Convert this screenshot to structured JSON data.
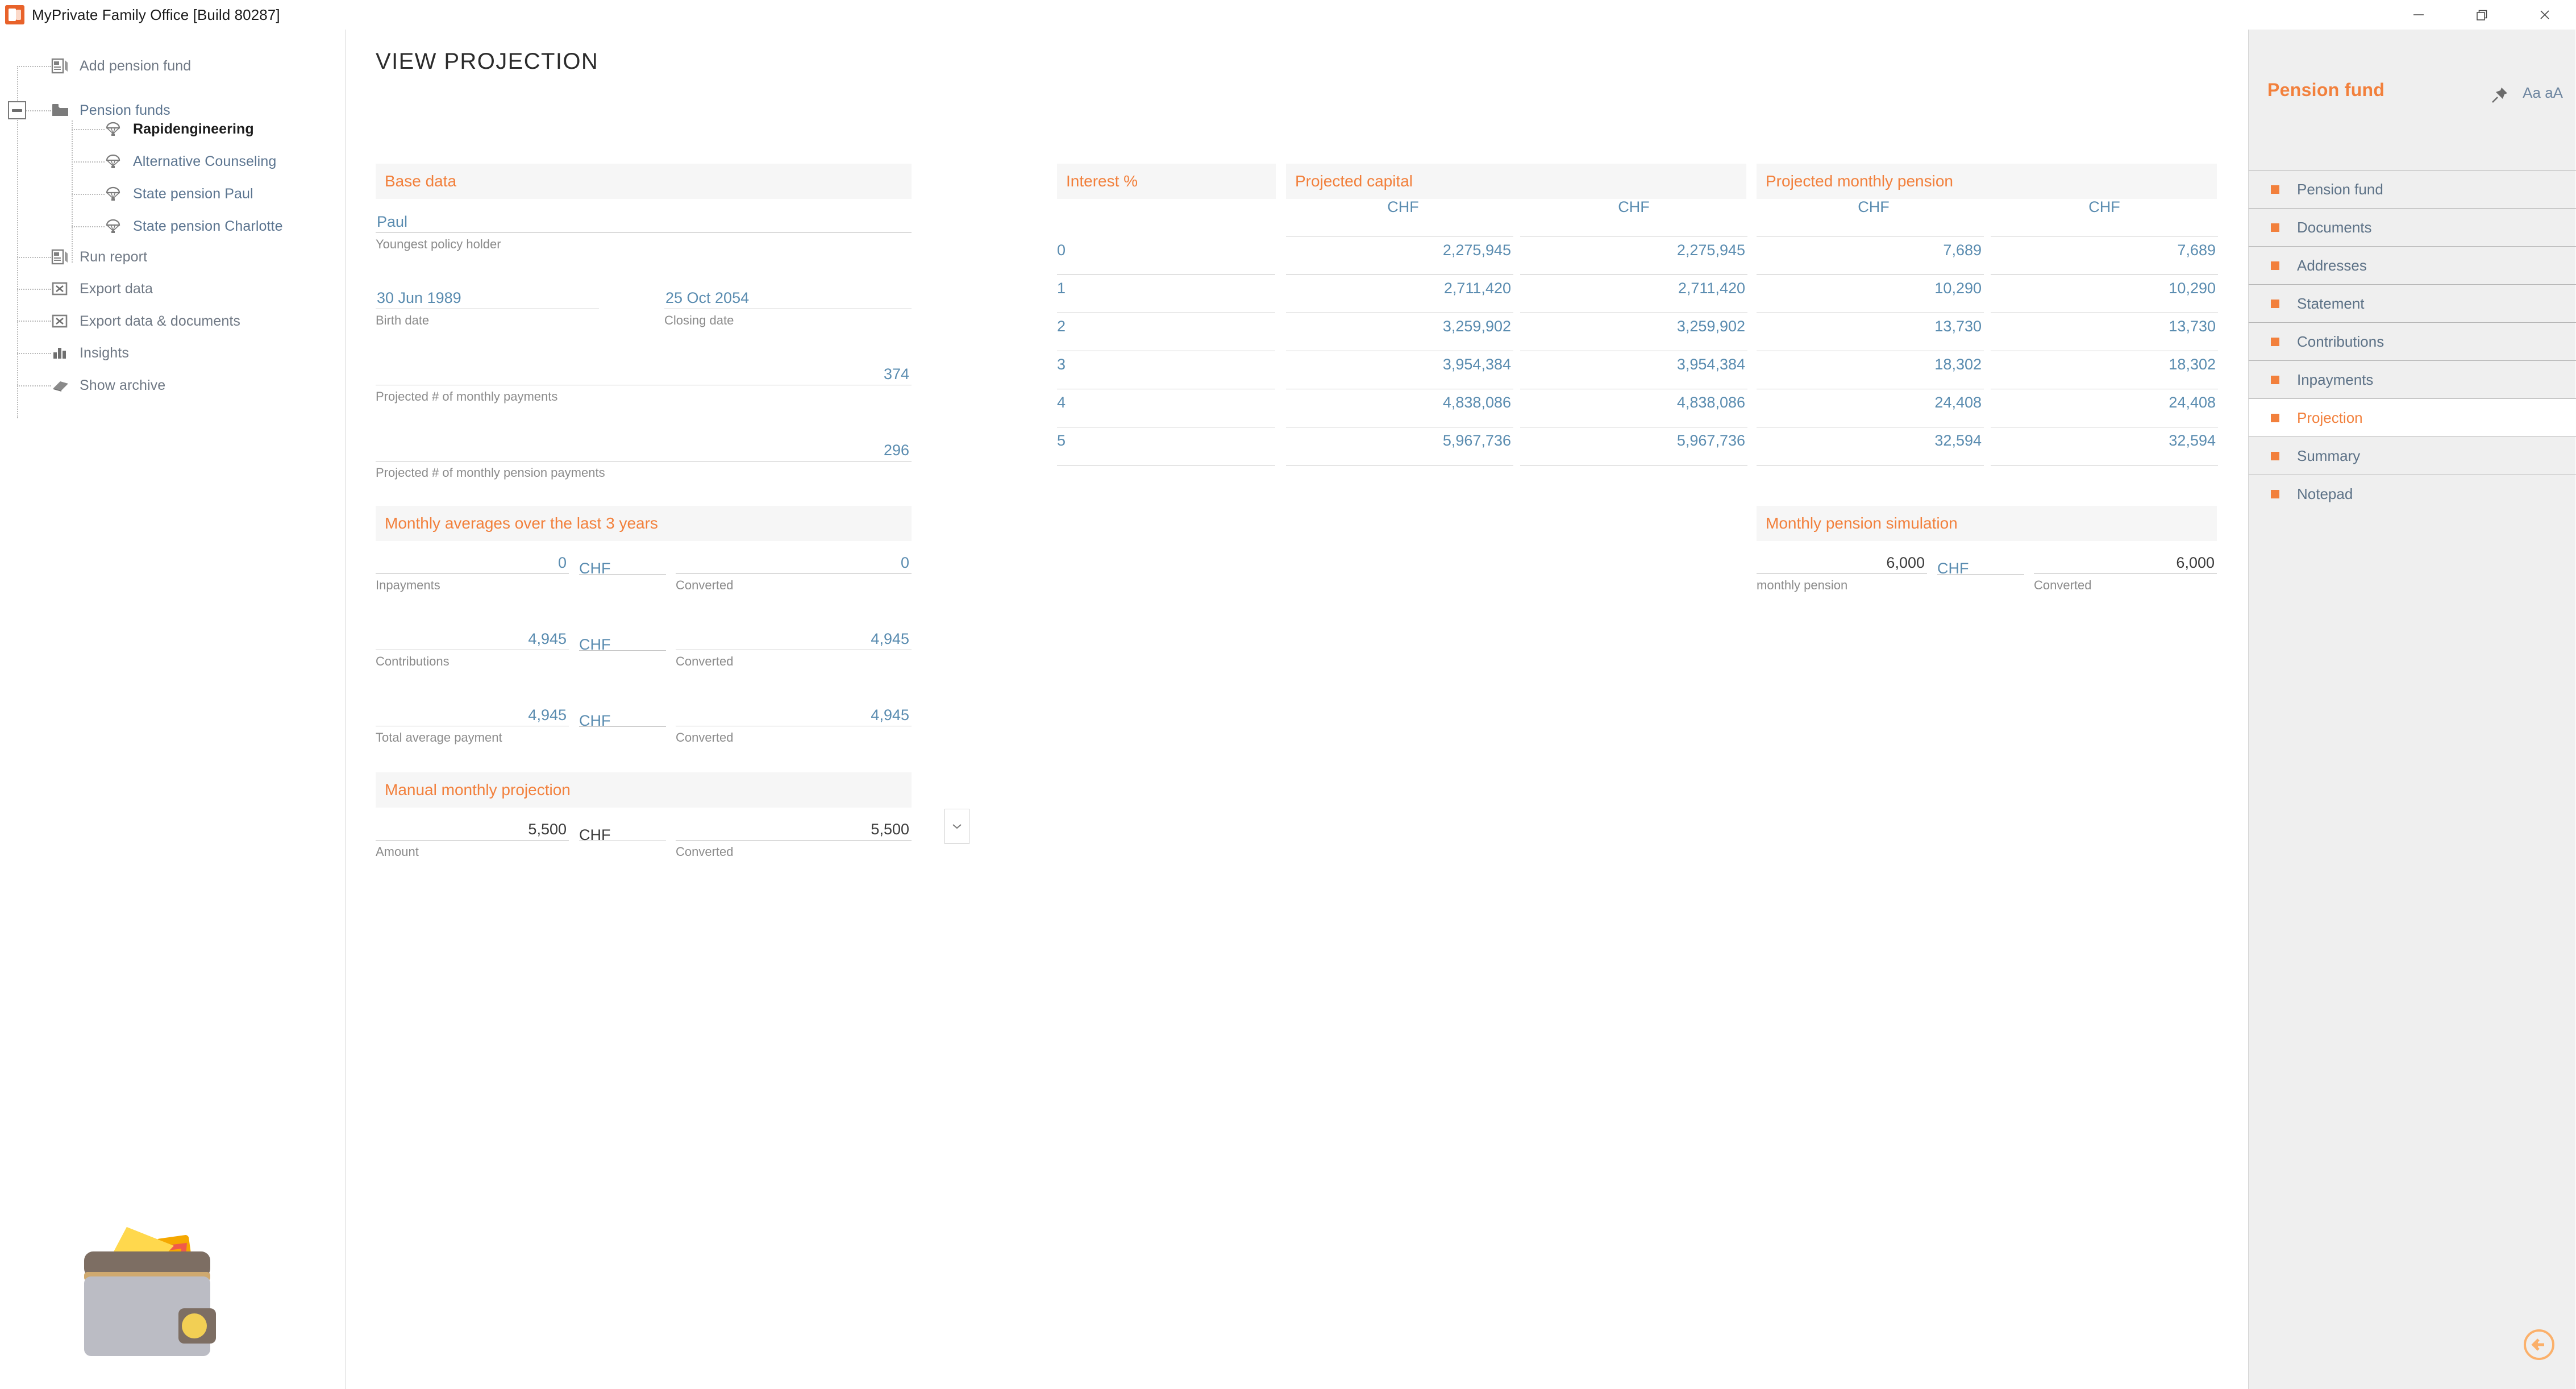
{
  "window": {
    "title": "MyPrivate Family Office [Build 80287]",
    "app_icon": "myprivate-app-icon",
    "controls": {
      "minimize": "minimize-icon",
      "restore": "restore-icon",
      "close": "close-icon"
    }
  },
  "tree": {
    "items": [
      {
        "label": "Add pension fund",
        "icon": "add-document-icon",
        "style": "gray",
        "level": 1
      },
      {
        "label": "Pension funds",
        "icon": "folder-icon",
        "style": "blue",
        "level": 1
      },
      {
        "label": "Rapidengineering",
        "icon": "parachute-icon",
        "style": "bold",
        "level": 2
      },
      {
        "label": "Alternative Counseling",
        "icon": "parachute-icon",
        "style": "blue",
        "level": 2
      },
      {
        "label": "State pension Paul",
        "icon": "parachute-icon",
        "style": "blue",
        "level": 2
      },
      {
        "label": "State pension Charlotte",
        "icon": "parachute-icon",
        "style": "blue",
        "level": 2
      },
      {
        "label": "Run report",
        "icon": "report-icon",
        "style": "gray",
        "level": 1
      },
      {
        "label": "Export data",
        "icon": "export-excel-icon",
        "style": "gray",
        "level": 1
      },
      {
        "label": "Export data & documents",
        "icon": "export-excel-icon",
        "style": "gray",
        "level": 1
      },
      {
        "label": "Insights",
        "icon": "bar-chart-icon",
        "style": "gray",
        "level": 1
      },
      {
        "label": "Show archive",
        "icon": "book-icon",
        "style": "gray",
        "level": 1
      }
    ],
    "expander": "collapse-toggle"
  },
  "main": {
    "page_title": "VIEW PROJECTION",
    "base_data": {
      "heading": "Base data",
      "policy_holder": {
        "value": "Paul",
        "caption": "Youngest policy holder"
      },
      "birth_date": {
        "value": "30 Jun 1989",
        "caption": "Birth date"
      },
      "closing_date": {
        "value": "25 Oct 2054",
        "caption": "Closing date"
      },
      "monthly_payments": {
        "value": "374",
        "caption": "Projected # of monthly payments"
      },
      "monthly_pension_payments": {
        "value": "296",
        "caption": "Projected # of monthly pension payments"
      }
    },
    "monthly_averages": {
      "heading": "Monthly averages over the last 3 years",
      "rows": [
        {
          "amount": "0",
          "currency": "CHF",
          "converted": "0",
          "caption": "Inpayments",
          "converted_caption": "Converted"
        },
        {
          "amount": "4,945",
          "currency": "CHF",
          "converted": "4,945",
          "caption": "Contributions",
          "converted_caption": "Converted"
        },
        {
          "amount": "4,945",
          "currency": "CHF",
          "converted": "4,945",
          "caption": "Total average payment",
          "converted_caption": "Converted"
        }
      ]
    },
    "manual_projection": {
      "heading": "Manual monthly projection",
      "amount": "5,500",
      "currency": "CHF",
      "converted": "5,500",
      "caption": "Amount",
      "converted_caption": "Converted",
      "dropdown_icon": "chevron-down-icon"
    },
    "pension_simulation": {
      "heading": "Monthly pension simulation",
      "amount": "6,000",
      "currency": "CHF",
      "converted": "6,000",
      "caption": "monthly pension",
      "converted_caption": "Converted"
    },
    "projection_table": {
      "headers": {
        "interest": "Interest %",
        "capital": "Projected capital",
        "pension": "Projected monthly pension"
      },
      "currency_headers": [
        "CHF",
        "CHF",
        "CHF",
        "CHF"
      ],
      "rows": [
        {
          "interest": "0",
          "capital": "2,275,945",
          "capital_conv": "2,275,945",
          "pension": "7,689",
          "pension_conv": "7,689"
        },
        {
          "interest": "1",
          "capital": "2,711,420",
          "capital_conv": "2,711,420",
          "pension": "10,290",
          "pension_conv": "10,290"
        },
        {
          "interest": "2",
          "capital": "3,259,902",
          "capital_conv": "3,259,902",
          "pension": "13,730",
          "pension_conv": "13,730"
        },
        {
          "interest": "3",
          "capital": "3,954,384",
          "capital_conv": "3,954,384",
          "pension": "18,302",
          "pension_conv": "18,302"
        },
        {
          "interest": "4",
          "capital": "4,838,086",
          "capital_conv": "4,838,086",
          "pension": "24,408",
          "pension_conv": "24,408"
        },
        {
          "interest": "5",
          "capital": "5,967,736",
          "capital_conv": "5,967,736",
          "pension": "32,594",
          "pension_conv": "32,594"
        }
      ]
    },
    "wallet_icon": "wallet-icon",
    "office_icon": "office-logo-icon",
    "back_button": "back-arrow-icon"
  },
  "right_panel": {
    "title": "Pension fund",
    "pin_icon": "pin-icon",
    "font_size_toggle": "Aa aA",
    "items": [
      {
        "label": "Pension fund",
        "active": false
      },
      {
        "label": "Documents",
        "active": false
      },
      {
        "label": "Addresses",
        "active": false
      },
      {
        "label": "Statement",
        "active": false
      },
      {
        "label": "Contributions",
        "active": false
      },
      {
        "label": "Inpayments",
        "active": false
      },
      {
        "label": "Projection",
        "active": true
      },
      {
        "label": "Summary",
        "active": false
      },
      {
        "label": "Notepad",
        "active": false
      }
    ]
  },
  "colors": {
    "accent_orange": "#f2803c",
    "value_blue": "#5a8cb0",
    "tree_blue": "#5c7590",
    "section_bg": "#f6f6f6",
    "panel_bg": "#efefef"
  }
}
